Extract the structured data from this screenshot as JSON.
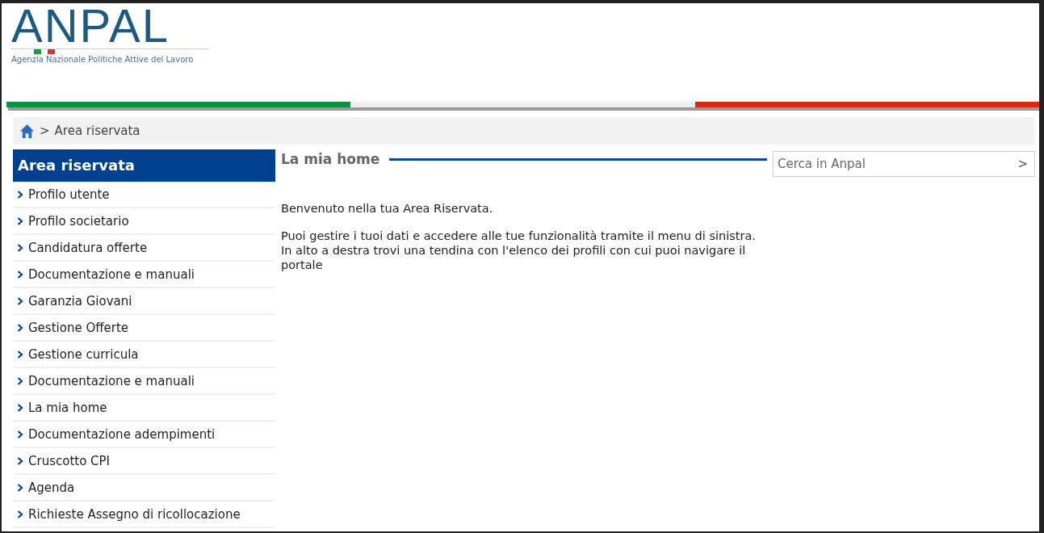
{
  "logo": {
    "name": "ANPAL",
    "subtitle": "Agenzia Nazionale Politiche Attive del Lavoro"
  },
  "breadcrumb": {
    "separator": ">",
    "current": "Area riservata"
  },
  "sidebar": {
    "title": "Area riservata",
    "items": [
      {
        "label": "Profilo utente"
      },
      {
        "label": "Profilo societario"
      },
      {
        "label": "Candidatura offerte"
      },
      {
        "label": "Documentazione e manuali"
      },
      {
        "label": "Garanzia Giovani"
      },
      {
        "label": "Gestione Offerte"
      },
      {
        "label": "Gestione curricula"
      },
      {
        "label": "Documentazione e manuali"
      },
      {
        "label": "La mia home"
      },
      {
        "label": "Documentazione adempimenti"
      },
      {
        "label": "Cruscotto CPI"
      },
      {
        "label": "Agenda"
      },
      {
        "label": "Richieste Assegno di ricollocazione"
      }
    ]
  },
  "main": {
    "title": "La mia home",
    "paragraphs": [
      "Benvenuto nella tua Area Riservata.",
      "Puoi gestire i tuoi dati e accedere alle tue funzionalità tramite il menu di sinistra. In alto a destra trovi una tendina con l'elenco dei profili con cui puoi navigare il portale"
    ]
  },
  "search": {
    "placeholder": "Cerca in Anpal",
    "button": ">"
  }
}
